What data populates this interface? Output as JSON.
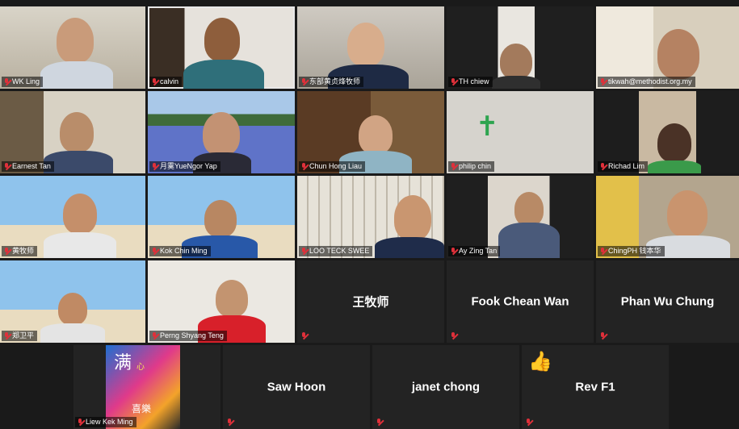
{
  "participants": [
    {
      "name": "WK Ling"
    },
    {
      "name": "calvin"
    },
    {
      "name": "东部黄贞烽牧师"
    },
    {
      "name": "TH chiew"
    },
    {
      "name": "tikwah@methodist.org.my"
    },
    {
      "name": "Earnest Tan"
    },
    {
      "name": "月霙YueNgor Yap"
    },
    {
      "name": "Chun Hong Liau"
    },
    {
      "name": "philip chin"
    },
    {
      "name": "Richad Lim"
    },
    {
      "name": "黄牧师"
    },
    {
      "name": "Kok Chin Ming"
    },
    {
      "name": "LOO TECK SWEE"
    },
    {
      "name": "Ay Zing Tan"
    },
    {
      "name": "ChingPH 钱本华"
    },
    {
      "name": "郑卫平"
    },
    {
      "name": "Perng Shyang Teng"
    },
    {
      "name": "王牧师"
    },
    {
      "name": "Fook Chean Wan"
    },
    {
      "name": "Phan Wu Chung"
    },
    {
      "name": "Liew Kek Ming",
      "poster_big_text": "满",
      "poster_small_text": "心",
      "poster_bottom_text": "喜樂"
    },
    {
      "name": "Saw Hoon"
    },
    {
      "name": "janet chong"
    },
    {
      "name": "Rev F1"
    }
  ],
  "colors": {
    "muted_mic": "#e0303a",
    "active_speaker_border": "#e8e8e8",
    "tile_bg": "#232323",
    "page_bg": "#1a1a1a"
  },
  "icons": {
    "muted": "microphone-muted-icon",
    "reaction": "thumbs-up-icon",
    "cross": "cross-icon"
  }
}
